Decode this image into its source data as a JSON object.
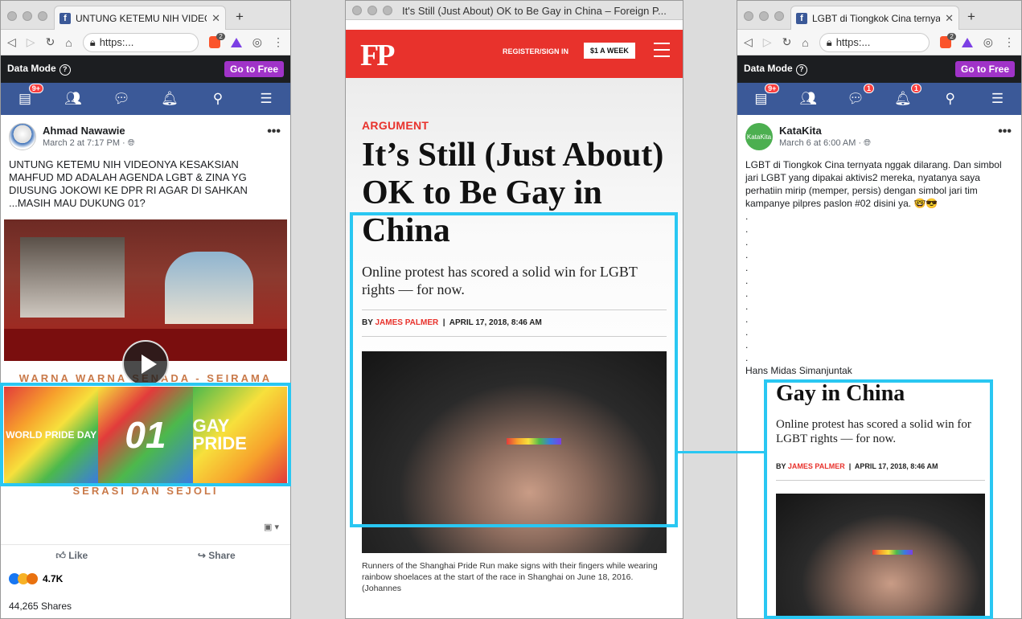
{
  "left_window": {
    "tab_title": "UNTUNG KETEMU NIH VIDEONYA",
    "new_tab": "+",
    "url": "https:...",
    "brave_count": "2",
    "data_mode": {
      "label": "Data Mode",
      "help": "?",
      "button": "Go to Free"
    },
    "nav_badge": "9+",
    "post": {
      "author": "Ahmad Nawawie",
      "time": "March 2 at 7:17 PM",
      "text": "UNTUNG KETEMU NIH VIDEONYA KESAKSIAN MAHFUD MD ADALAH AGENDA LGBT & ZINA YG DIUSUNG JOKOWI KE DPR RI AGAR DI SAHKAN ...MASIH MAU DUKUNG 01?",
      "caption_top": "WARNA WARNA SENADA - SEIRAMA",
      "pride_1": "WORLD PRIDE DAY",
      "pride_2": "01",
      "pride_3": "GAY PRIDE",
      "caption_bottom": "SERASI DAN SEJOLI",
      "like": "Like",
      "share": "Share",
      "reactions": "4.7K",
      "shares": "44,265 Shares"
    }
  },
  "middle_window": {
    "window_title": "It's Still (Just About) OK to Be Gay in China – Foreign P...",
    "logo": "FP",
    "register": "REGISTER/SIGN IN",
    "subscribe": "$1 A WEEK",
    "category": "ARGUMENT",
    "title": "It’s Still (Just About) OK to Be Gay in China",
    "dek": "Online protest has scored a solid win for LGBT rights — for now.",
    "by": "BY",
    "author": "JAMES PALMER",
    "date": "APRIL 17, 2018, 8:46 AM",
    "photo_caption": "Runners of the Shanghai Pride Run make signs with their fingers while wearing rainbow shoelaces at the start of the race in Shanghai on June 18, 2016. (Johannes"
  },
  "right_window": {
    "tab_title": "LGBT di Tiongkok Cina ternyata",
    "new_tab": "+",
    "url": "https:...",
    "brave_count": "2",
    "data_mode": {
      "label": "Data Mode",
      "help": "?",
      "button": "Go to Free"
    },
    "badges": {
      "home": "9+",
      "messenger": "1",
      "notifications": "1"
    },
    "post": {
      "author": "KataKita",
      "avatar_text": "KataKita",
      "time": "March 6 at 6:00 AM",
      "text": "LGBT di Tiongkok Cina ternyata nggak dilarang. Dan simbol jari LGBT yang dipakai aktivis2 mereka, nyatanya saya perhatiin mirip (memper, persis) dengan simbol jari tim kampanye pilpres paslon #02 disini ya. 🤓😎",
      "dots": [
        ".",
        ".",
        ".",
        ".",
        ".",
        ".",
        ".",
        ".",
        ".",
        ".",
        ".",
        "."
      ],
      "signature": "Hans Midas Simanjuntak"
    },
    "embed": {
      "title": "Gay in China",
      "dek": "Online protest has scored a solid win for LGBT rights — for now.",
      "by": "BY",
      "author": "JAMES PALMER",
      "date": "APRIL 17, 2018, 8:46 AM"
    }
  },
  "colors": {
    "facebook_blue": "#3b5998",
    "fp_red": "#e8322c",
    "highlight": "#29c7f2",
    "go_free": "#a033c8"
  }
}
